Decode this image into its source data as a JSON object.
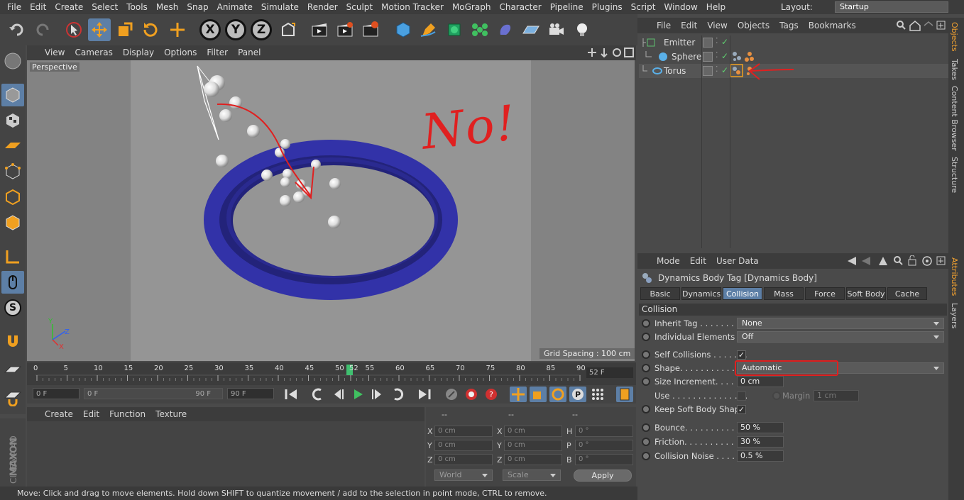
{
  "menubar": [
    "File",
    "Edit",
    "Create",
    "Select",
    "Tools",
    "Mesh",
    "Snap",
    "Animate",
    "Simulate",
    "Render",
    "Sculpt",
    "Motion Tracker",
    "MoGraph",
    "Character",
    "Pipeline",
    "Plugins",
    "Script",
    "Window",
    "Help"
  ],
  "layout": {
    "label": "Layout:",
    "value": "Startup"
  },
  "toolbar": {
    "axis_x": "X",
    "axis_y": "Y",
    "axis_z": "Z"
  },
  "left_toolbar": {
    "snap_s": "S"
  },
  "viewport": {
    "menu": [
      "View",
      "Cameras",
      "Display",
      "Options",
      "Filter",
      "Panel"
    ],
    "label": "Perspective",
    "grid_spacing": "Grid Spacing : 100 cm",
    "annotation_text": "No!",
    "axis_y": "Y",
    "axis_z": "Z",
    "axis_x": "X"
  },
  "timeline": {
    "ticks": [
      "0",
      "5",
      "10",
      "15",
      "20",
      "25",
      "30",
      "35",
      "40",
      "45",
      "50",
      "52",
      "55",
      "60",
      "65",
      "70",
      "75",
      "80",
      "85",
      "90"
    ],
    "frame_field": "52 F",
    "current": "52"
  },
  "playbar": {
    "start": "0 F",
    "range_start": "0 F",
    "range_end": "90 F",
    "end": "90 F"
  },
  "material": {
    "menu": [
      "Create",
      "Edit",
      "Function",
      "Texture"
    ]
  },
  "coords": {
    "header": [
      "--",
      "--",
      "--"
    ],
    "rows": [
      {
        "l1": "X",
        "v1": "0 cm",
        "l2": "X",
        "v2": "0 cm",
        "l3": "H",
        "v3": "0 °"
      },
      {
        "l1": "Y",
        "v1": "0 cm",
        "l2": "Y",
        "v2": "0 cm",
        "l3": "P",
        "v3": "0 °"
      },
      {
        "l1": "Z",
        "v1": "0 cm",
        "l2": "Z",
        "v2": "0 cm",
        "l3": "B",
        "v3": "0 °"
      }
    ],
    "world": "World",
    "scale": "Scale",
    "apply": "Apply"
  },
  "status": "Move: Click and drag to move elements. Hold down SHIFT to quantize movement / add to the selection in point mode, CTRL to remove.",
  "maxon": {
    "brand": "MAXON",
    "product": "CINEMA 4D"
  },
  "objects": {
    "menu": [
      "File",
      "Edit",
      "View",
      "Objects",
      "Tags",
      "Bookmarks"
    ],
    "items": [
      {
        "name": "Emitter"
      },
      {
        "name": "Sphere"
      },
      {
        "name": "Torus"
      }
    ]
  },
  "attributes": {
    "menu": [
      "Mode",
      "Edit",
      "User Data"
    ],
    "title": "Dynamics Body Tag [Dynamics Body]",
    "tabs": [
      "Basic",
      "Dynamics",
      "Collision",
      "Mass",
      "Force",
      "Soft Body",
      "Cache"
    ],
    "active_tab": "Collision",
    "section": "Collision",
    "inherit_tag": {
      "label": "Inherit Tag . . . . . . . . . .",
      "value": "None"
    },
    "individual": {
      "label": "Individual Elements . . .",
      "value": "Off"
    },
    "self_collisions": {
      "label": "Self Collisions . . . . . . .",
      "check": "✓"
    },
    "shape": {
      "label": "Shape. . . . . . . . . . . . . . .",
      "value": "Automatic"
    },
    "size_increment": {
      "label": "Size Increment. . . . . . .",
      "value": "0 cm"
    },
    "use": {
      "label": "Use . . . . . . . . . . . . . . .",
      "margin_label": "Margin",
      "margin_value": "1 cm"
    },
    "keep_soft": {
      "label": "Keep Soft Body Shape",
      "check": "✓"
    },
    "bounce": {
      "label": "Bounce. . . . . . . . . . . . .",
      "value": "50 %"
    },
    "friction": {
      "label": "Friction. . . . . . . . . . . . .",
      "value": "30 %"
    },
    "noise": {
      "label": "Collision Noise . . . . . .",
      "value": "0.5 %"
    }
  },
  "side_tabs": {
    "objects": "Objects",
    "takes": "Takes",
    "content": "Content Browser",
    "structure": "Structure",
    "attributes": "Attributes",
    "layers": "Layers"
  },
  "colors": {
    "accent": "#5d7fa6",
    "torus": "#2a2a8a",
    "annotation": "#e02020"
  }
}
